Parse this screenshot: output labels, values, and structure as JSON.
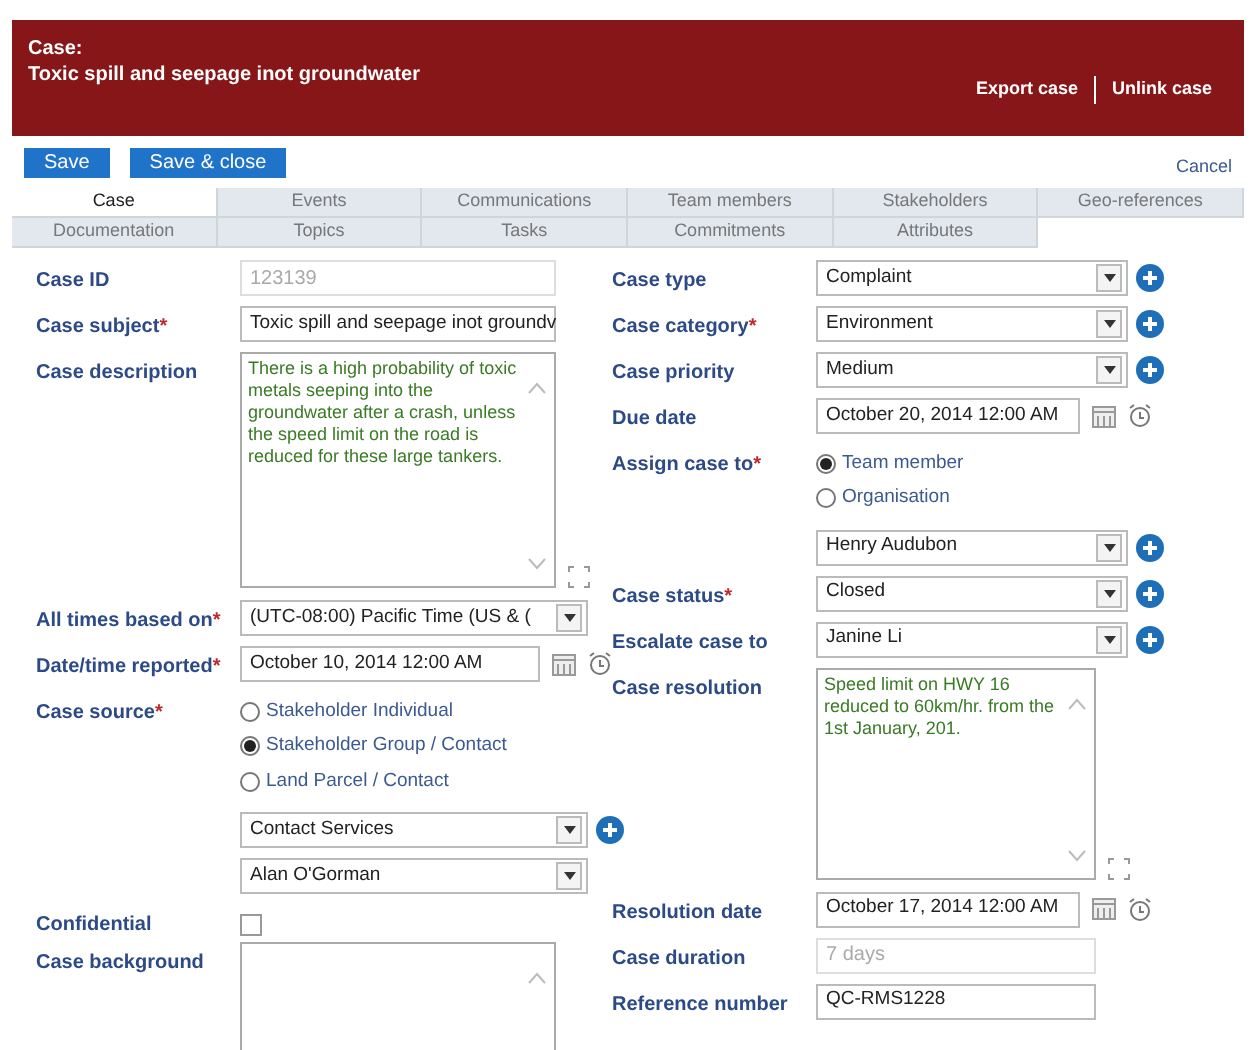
{
  "header": {
    "label": "Case:",
    "title": "Toxic spill and seepage inot groundwater",
    "links": [
      "Export case",
      "Unlink case"
    ]
  },
  "toolbar": {
    "buttons": [
      "Save",
      "Save & close"
    ],
    "cancel": "Cancel"
  },
  "tabs": [
    [
      {
        "label": "Case",
        "selected": true
      },
      {
        "label": "Events",
        "selected": false
      },
      {
        "label": "Communications",
        "selected": false
      },
      {
        "label": "Team members",
        "selected": false
      },
      {
        "label": "Stakeholders",
        "selected": false
      },
      {
        "label": "Geo-references",
        "selected": false
      }
    ],
    [
      {
        "label": "Documentation",
        "selected": false
      },
      {
        "label": "Topics",
        "selected": false
      },
      {
        "label": "Tasks",
        "selected": false
      },
      {
        "label": "Commitments",
        "selected": false
      },
      {
        "label": "Attributes",
        "selected": false
      }
    ]
  ],
  "left_fields": [
    {
      "kind": "readonly",
      "label": "Case ID",
      "value": "123139"
    },
    {
      "kind": "text",
      "label": "Case subject",
      "required_mark": "*",
      "value": "Toxic spill and seepage inot groundv"
    },
    {
      "kind": "textarea",
      "label": "Case description",
      "value": "There is a high probability of toxic metals seeping into the groundwater after a crash, unless the speed limit on the road is reduced for these large tankers."
    },
    {
      "kind": "select",
      "label": "All times based on",
      "required_mark": "*",
      "value": "(UTC-08:00) Pacific Time (US & (",
      "add_button": false
    },
    {
      "kind": "date",
      "label": "Date/time reported",
      "required_mark": "*",
      "value": "October 10, 2014 12:00 AM"
    },
    {
      "kind": "radio",
      "label": "Case source",
      "required_mark": "*",
      "options": [
        {
          "label": "Stakeholder Individual",
          "selected": false
        },
        {
          "label": "Stakeholder Group / Contact",
          "selected": true
        },
        {
          "label": "Land Parcel / Contact",
          "selected": false
        }
      ]
    },
    {
      "kind": "select",
      "value": "Contact Services",
      "add_button": true
    },
    {
      "kind": "select",
      "value": "Alan O'Gorman",
      "add_button": false
    },
    {
      "kind": "checkbox",
      "label": "Confidential",
      "checked": false
    },
    {
      "kind": "textarea",
      "label": "Case background"
    }
  ],
  "right_fields": [
    {
      "kind": "select",
      "label": "Case type",
      "value": "Complaint",
      "add_button": true
    },
    {
      "kind": "select",
      "label": "Case category",
      "required_mark": "*",
      "value": "Environment",
      "add_button": true
    },
    {
      "kind": "select",
      "label": "Case priority",
      "value": "Medium",
      "add_button": true
    },
    {
      "kind": "date",
      "label": "Due date",
      "value": "October 20, 2014 12:00 AM"
    },
    {
      "kind": "radio",
      "label": "Assign case to",
      "required_mark": "*",
      "options": [
        {
          "label": "Team member",
          "selected": true
        },
        {
          "label": "Organisation",
          "selected": false
        }
      ]
    },
    {
      "kind": "select",
      "value": "Henry Audubon",
      "add_button": true
    },
    {
      "kind": "select",
      "label": "Case status",
      "required_mark": "*",
      "value": "Closed",
      "add_button": true
    },
    {
      "kind": "select",
      "label": "Escalate case to",
      "value": "Janine Li",
      "add_button": true
    },
    {
      "kind": "textarea",
      "label": "Case resolution",
      "value": "Speed limit on HWY 16 reduced to 60km/hr. from the 1st January, 201."
    },
    {
      "kind": "date",
      "label": "Resolution date",
      "value": "October 17, 2014 12:00 AM"
    },
    {
      "kind": "readonly",
      "label": "Case duration",
      "value": "7 days"
    },
    {
      "kind": "text",
      "label": "Reference number",
      "value": "QC-RMS1228"
    }
  ]
}
